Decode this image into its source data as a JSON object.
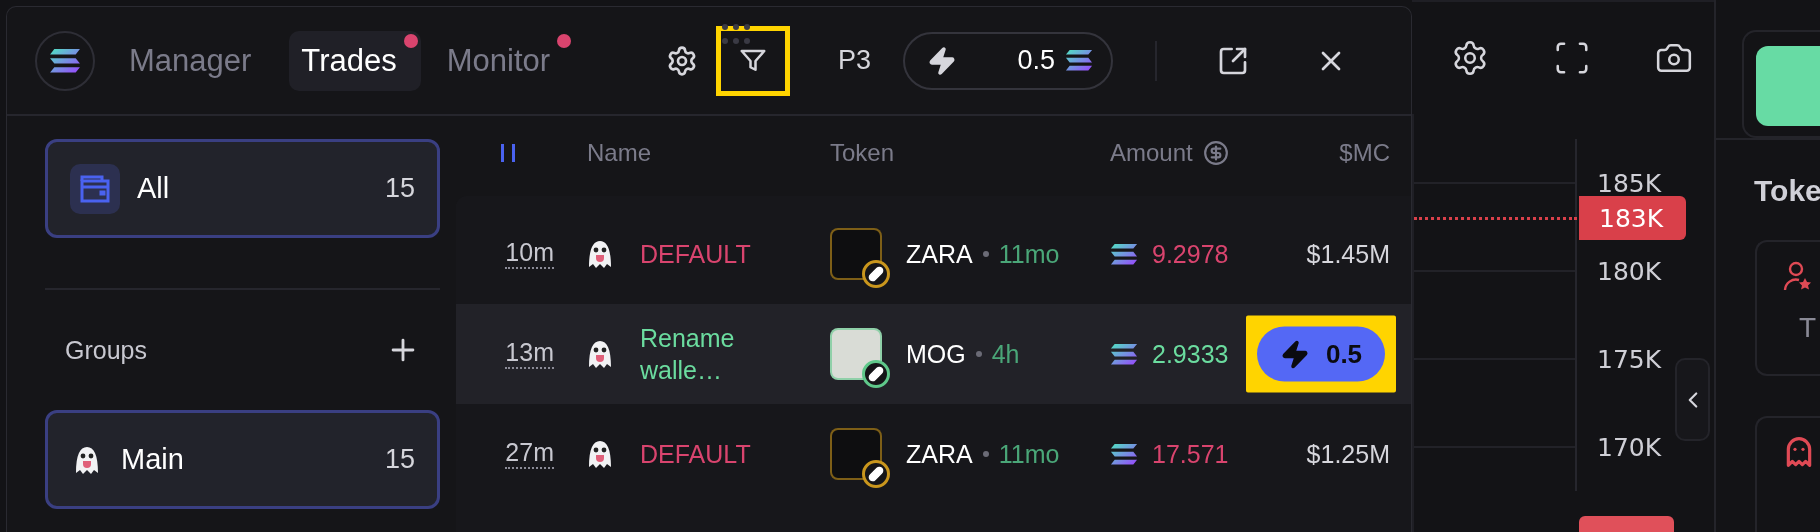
{
  "header": {
    "tabs": [
      {
        "label": "Manager",
        "selected": false,
        "notification": false
      },
      {
        "label": "Trades",
        "selected": true,
        "notification": true
      },
      {
        "label": "Monitor",
        "selected": false,
        "notification": true
      }
    ],
    "filter": {
      "highlighted": true
    },
    "preset": "P3",
    "quick_buy": {
      "amount": "0.5"
    }
  },
  "sidebar": {
    "all": {
      "label": "All",
      "count": "15",
      "selected": true
    },
    "groups_label": "Groups",
    "groups": [
      {
        "label": "Main",
        "count": "15",
        "selected": true
      }
    ]
  },
  "table": {
    "columns": [
      "Name",
      "Token",
      "Amount",
      "$MC"
    ],
    "rows": [
      {
        "kind": "sell",
        "time": "10m",
        "name": "DEFAULT",
        "token": "ZARA",
        "age": "11mo",
        "amount": "9.2978",
        "mc": "$1.45M",
        "hovered": false
      },
      {
        "kind": "buy",
        "time": "13m",
        "name": "Rename walle…",
        "token": "MOG",
        "age": "4h",
        "amount": "2.9333",
        "hovered": true,
        "quick_buy": {
          "amount": "0.5",
          "highlighted": true
        }
      },
      {
        "kind": "sell",
        "time": "27m",
        "name": "DEFAULT",
        "token": "ZARA",
        "age": "11mo",
        "amount": "17.571",
        "mc": "$1.25M",
        "hovered": false
      }
    ]
  },
  "price_axis": {
    "labels": [
      "185K",
      "180K",
      "175K",
      "170K"
    ],
    "current": "183K"
  },
  "right_panel": {
    "title": "Toke",
    "cards": [
      {
        "kind": "person",
        "label": "T"
      },
      {
        "kind": "ghost"
      }
    ]
  }
}
